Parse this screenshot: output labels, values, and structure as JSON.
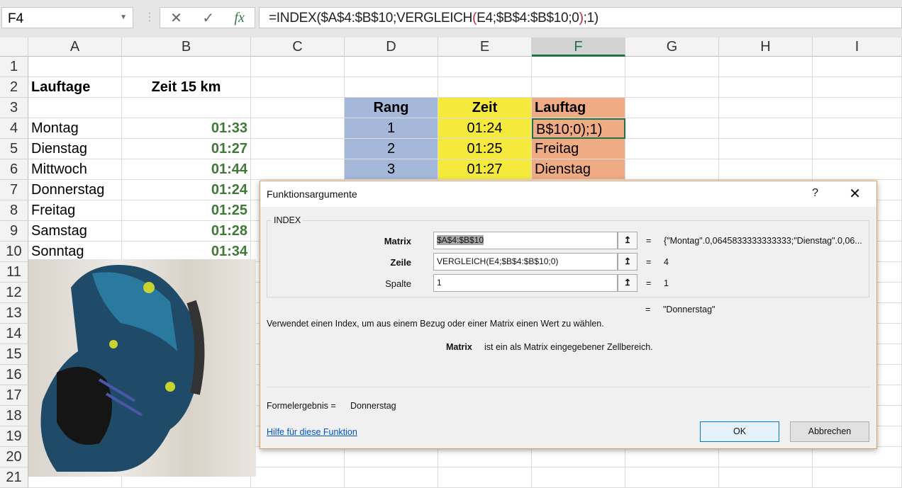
{
  "formula_bar": {
    "name_box": "F4",
    "cancel": "✕",
    "enter": "✓",
    "fx": "fx",
    "formula_pre": "=INDEX($A$4:$B$10;VERGLEICH",
    "paren_open": "(",
    "formula_mid": "E4;$B$4:$B$10;0",
    "paren_close": ")",
    "formula_post": ";1)"
  },
  "columns": [
    "A",
    "B",
    "C",
    "D",
    "E",
    "F",
    "G",
    "H",
    "I"
  ],
  "rows": [
    "1",
    "2",
    "3",
    "4",
    "5",
    "6",
    "7",
    "8",
    "9",
    "10",
    "11",
    "12",
    "13",
    "14",
    "15",
    "16",
    "17",
    "18",
    "19",
    "20",
    "21"
  ],
  "sheet": {
    "a2": "Lauftage",
    "b2": "Zeit 15 km",
    "days": [
      "Montag",
      "Dienstag",
      "Mittwoch",
      "Donnerstag",
      "Freitag",
      "Samstag",
      "Sonntag"
    ],
    "times": [
      "01:33",
      "01:27",
      "01:44",
      "01:24",
      "01:25",
      "01:28",
      "01:34"
    ],
    "d3": "Rang",
    "e3": "Zeit",
    "f3": "Lauftag",
    "rank": [
      "1",
      "2",
      "3"
    ],
    "rank_time": [
      "01:24",
      "01:25",
      "01:27"
    ],
    "rank_day": [
      "B$10;0);1)",
      "Freitag",
      "Dienstag"
    ]
  },
  "dialog": {
    "title": "Funktionsargumente",
    "help_q": "?",
    "close": "✕",
    "function": "INDEX",
    "args": [
      {
        "label": "Matrix",
        "value": "$A$4:$B$10",
        "result": "{\"Montag\".0,0645833333333333;\"Dienstag\".0,06..."
      },
      {
        "label": "Zeile",
        "value": "VERGLEICH(E4;$B$4:$B$10;0)",
        "result": "4"
      },
      {
        "label": "Spalte",
        "value": "1",
        "result": "1"
      }
    ],
    "eq": "=",
    "overall_result": "\"Donnerstag\"",
    "description": "Verwendet einen Index, um aus einem Bezug oder einer Matrix einen Wert zu wählen.",
    "arg_help_name": "Matrix",
    "arg_help_text": "ist ein als Matrix eingegebener Zellbereich.",
    "formula_result_label": "Formelergebnis =",
    "formula_result": "Donnerstag",
    "help_link": "Hilfe für diese Funktion",
    "ok": "OK",
    "cancel": "Abbrechen"
  }
}
